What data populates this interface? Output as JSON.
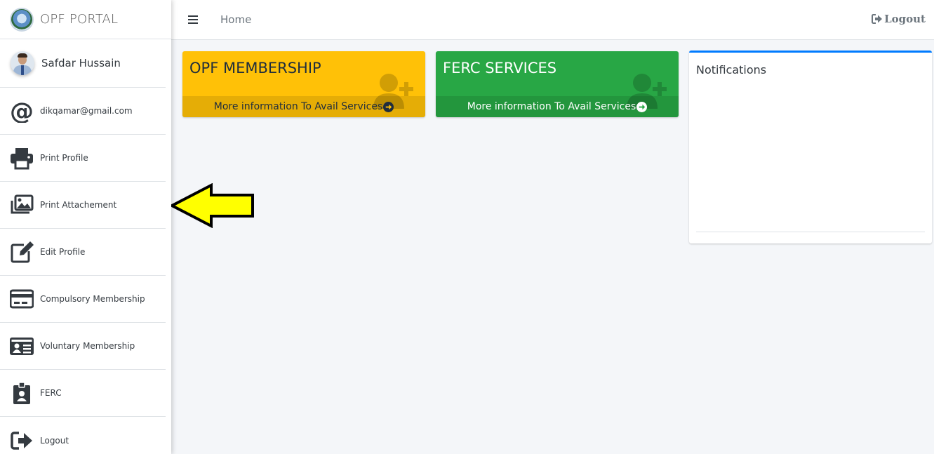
{
  "brand": {
    "title": "OPF PORTAL"
  },
  "user": {
    "name": "Safdar Hussain"
  },
  "sidebar": {
    "items": [
      {
        "label": "dikqamar@gmail.com",
        "icon": "at-icon"
      },
      {
        "label": "Print Profile",
        "icon": "printer-icon"
      },
      {
        "label": "Print Attachement",
        "icon": "images-icon"
      },
      {
        "label": "Edit Profile",
        "icon": "edit-icon"
      },
      {
        "label": "Compulsory Membership",
        "icon": "credit-card-icon"
      },
      {
        "label": "Voluntary Membership",
        "icon": "id-card-icon"
      },
      {
        "label": "FERC",
        "icon": "id-badge-icon"
      },
      {
        "label": "Logout",
        "icon": "sign-out-icon"
      }
    ]
  },
  "topbar": {
    "home": "Home",
    "logout": "Logout"
  },
  "boxes": {
    "membership": {
      "title": "OPF MEMBERSHIP",
      "footer": "More information To Avail Services",
      "color": "#ffc107"
    },
    "ferc": {
      "title": "FERC SERVICES",
      "footer": "More information To Avail Services",
      "color": "#28a745"
    }
  },
  "notifications": {
    "title": "Notifications"
  },
  "colors": {
    "accent": "#007bff",
    "arrow": "#ffff00"
  }
}
